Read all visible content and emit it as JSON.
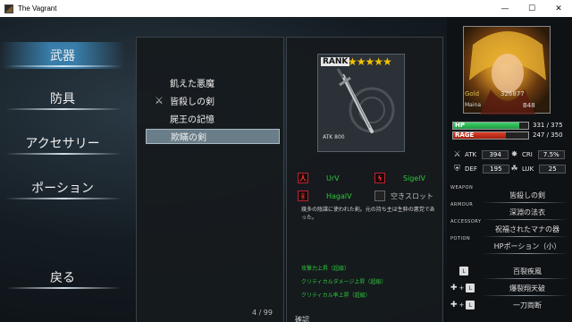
{
  "window": {
    "title": "The Vagrant",
    "minimize": "—",
    "maximize": "☐",
    "close": "✕"
  },
  "menu": [
    {
      "label": "武器",
      "active": true
    },
    {
      "label": "防具"
    },
    {
      "label": "アクセサリー"
    },
    {
      "label": "ポーション"
    },
    {
      "label": "戻る"
    }
  ],
  "item_list": {
    "items": [
      "飢えた悪魔",
      "皆殺しの剣",
      "屍王の記憶",
      "欺瞞の剣"
    ],
    "equipped_index": 1,
    "selected_index": 3,
    "page": "4 / 99"
  },
  "detail": {
    "rank_label": "RANK",
    "stars": "★★★★★",
    "atk": "ATK 800",
    "slots": [
      {
        "icon": "人",
        "label": "UrV"
      },
      {
        "icon": "ϟ",
        "label": "SigelV"
      },
      {
        "icon": "ᚺ",
        "label": "HagalV"
      },
      {
        "icon": "",
        "label": "空きスロット",
        "empty": true
      }
    ],
    "description": "幾多の陰謀に使われた剣。元の持ち主は生粋の悪党であった。",
    "bonuses": [
      "攻撃力上昇（超級）",
      "クリティカルダメージ上昇（超級）",
      "クリティカル率上昇（超級）"
    ]
  },
  "character": {
    "gold_label": "Gold",
    "gold": "326877",
    "name": "Maina",
    "level": "B48",
    "hp_label": "HP",
    "hp": "331 / 375",
    "hp_ratio": 0.883,
    "rage_label": "RAGE",
    "rage": "247 / 350",
    "rage_ratio": 0.706,
    "stats": {
      "atk_label": "ATK",
      "atk": "394",
      "cri_label": "CRI",
      "cri": "7.5%",
      "def_label": "DEF",
      "def": "195",
      "luk_label": "LUK",
      "luk": "25"
    },
    "equipment": {
      "weapon_label": "WEAPON",
      "weapon": "皆殺しの剣",
      "armour_label": "ARMOUR",
      "armour": "深淵の法衣",
      "accessory_label": "ACCESSORY",
      "accessory": "祝福されたマナの器",
      "potion_label": "POTION",
      "potion": "HPポーション（小）"
    },
    "skills": [
      {
        "keys": "L",
        "name": "百裂疾風"
      },
      {
        "keys": "✚ + L",
        "name": "爆裂翔天破"
      },
      {
        "keys": "✚ + L",
        "name": "一刀両断"
      }
    ]
  },
  "footer": {
    "hint": "確認"
  }
}
